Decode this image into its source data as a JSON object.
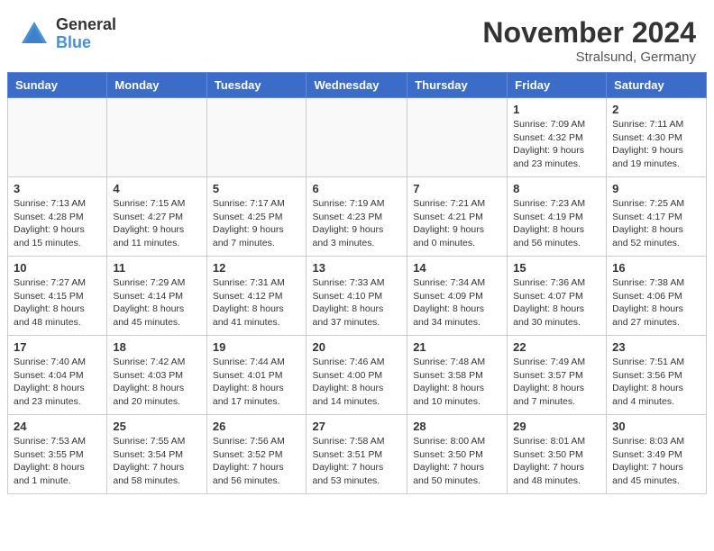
{
  "header": {
    "logo_general": "General",
    "logo_blue": "Blue",
    "title": "November 2024",
    "subtitle": "Stralsund, Germany"
  },
  "weekdays": [
    "Sunday",
    "Monday",
    "Tuesday",
    "Wednesday",
    "Thursday",
    "Friday",
    "Saturday"
  ],
  "weeks": [
    [
      {
        "day": "",
        "info": ""
      },
      {
        "day": "",
        "info": ""
      },
      {
        "day": "",
        "info": ""
      },
      {
        "day": "",
        "info": ""
      },
      {
        "day": "",
        "info": ""
      },
      {
        "day": "1",
        "info": "Sunrise: 7:09 AM\nSunset: 4:32 PM\nDaylight: 9 hours\nand 23 minutes."
      },
      {
        "day": "2",
        "info": "Sunrise: 7:11 AM\nSunset: 4:30 PM\nDaylight: 9 hours\nand 19 minutes."
      }
    ],
    [
      {
        "day": "3",
        "info": "Sunrise: 7:13 AM\nSunset: 4:28 PM\nDaylight: 9 hours\nand 15 minutes."
      },
      {
        "day": "4",
        "info": "Sunrise: 7:15 AM\nSunset: 4:27 PM\nDaylight: 9 hours\nand 11 minutes."
      },
      {
        "day": "5",
        "info": "Sunrise: 7:17 AM\nSunset: 4:25 PM\nDaylight: 9 hours\nand 7 minutes."
      },
      {
        "day": "6",
        "info": "Sunrise: 7:19 AM\nSunset: 4:23 PM\nDaylight: 9 hours\nand 3 minutes."
      },
      {
        "day": "7",
        "info": "Sunrise: 7:21 AM\nSunset: 4:21 PM\nDaylight: 9 hours\nand 0 minutes."
      },
      {
        "day": "8",
        "info": "Sunrise: 7:23 AM\nSunset: 4:19 PM\nDaylight: 8 hours\nand 56 minutes."
      },
      {
        "day": "9",
        "info": "Sunrise: 7:25 AM\nSunset: 4:17 PM\nDaylight: 8 hours\nand 52 minutes."
      }
    ],
    [
      {
        "day": "10",
        "info": "Sunrise: 7:27 AM\nSunset: 4:15 PM\nDaylight: 8 hours\nand 48 minutes."
      },
      {
        "day": "11",
        "info": "Sunrise: 7:29 AM\nSunset: 4:14 PM\nDaylight: 8 hours\nand 45 minutes."
      },
      {
        "day": "12",
        "info": "Sunrise: 7:31 AM\nSunset: 4:12 PM\nDaylight: 8 hours\nand 41 minutes."
      },
      {
        "day": "13",
        "info": "Sunrise: 7:33 AM\nSunset: 4:10 PM\nDaylight: 8 hours\nand 37 minutes."
      },
      {
        "day": "14",
        "info": "Sunrise: 7:34 AM\nSunset: 4:09 PM\nDaylight: 8 hours\nand 34 minutes."
      },
      {
        "day": "15",
        "info": "Sunrise: 7:36 AM\nSunset: 4:07 PM\nDaylight: 8 hours\nand 30 minutes."
      },
      {
        "day": "16",
        "info": "Sunrise: 7:38 AM\nSunset: 4:06 PM\nDaylight: 8 hours\nand 27 minutes."
      }
    ],
    [
      {
        "day": "17",
        "info": "Sunrise: 7:40 AM\nSunset: 4:04 PM\nDaylight: 8 hours\nand 23 minutes."
      },
      {
        "day": "18",
        "info": "Sunrise: 7:42 AM\nSunset: 4:03 PM\nDaylight: 8 hours\nand 20 minutes."
      },
      {
        "day": "19",
        "info": "Sunrise: 7:44 AM\nSunset: 4:01 PM\nDaylight: 8 hours\nand 17 minutes."
      },
      {
        "day": "20",
        "info": "Sunrise: 7:46 AM\nSunset: 4:00 PM\nDaylight: 8 hours\nand 14 minutes."
      },
      {
        "day": "21",
        "info": "Sunrise: 7:48 AM\nSunset: 3:58 PM\nDaylight: 8 hours\nand 10 minutes."
      },
      {
        "day": "22",
        "info": "Sunrise: 7:49 AM\nSunset: 3:57 PM\nDaylight: 8 hours\nand 7 minutes."
      },
      {
        "day": "23",
        "info": "Sunrise: 7:51 AM\nSunset: 3:56 PM\nDaylight: 8 hours\nand 4 minutes."
      }
    ],
    [
      {
        "day": "24",
        "info": "Sunrise: 7:53 AM\nSunset: 3:55 PM\nDaylight: 8 hours\nand 1 minute."
      },
      {
        "day": "25",
        "info": "Sunrise: 7:55 AM\nSunset: 3:54 PM\nDaylight: 7 hours\nand 58 minutes."
      },
      {
        "day": "26",
        "info": "Sunrise: 7:56 AM\nSunset: 3:52 PM\nDaylight: 7 hours\nand 56 minutes."
      },
      {
        "day": "27",
        "info": "Sunrise: 7:58 AM\nSunset: 3:51 PM\nDaylight: 7 hours\nand 53 minutes."
      },
      {
        "day": "28",
        "info": "Sunrise: 8:00 AM\nSunset: 3:50 PM\nDaylight: 7 hours\nand 50 minutes."
      },
      {
        "day": "29",
        "info": "Sunrise: 8:01 AM\nSunset: 3:50 PM\nDaylight: 7 hours\nand 48 minutes."
      },
      {
        "day": "30",
        "info": "Sunrise: 8:03 AM\nSunset: 3:49 PM\nDaylight: 7 hours\nand 45 minutes."
      }
    ]
  ]
}
